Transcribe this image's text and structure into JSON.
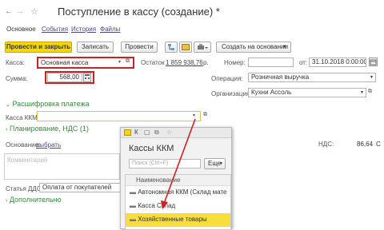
{
  "nav": {
    "back": "←",
    "forward": "→",
    "star": "☆"
  },
  "title": "Поступление в кассу (создание) *",
  "tabs": [
    "Основное",
    "События",
    "История",
    "Файлы"
  ],
  "toolbar": {
    "post_close": "Провести и закрыть",
    "save": "Записать",
    "post": "Провести",
    "create_based": "Создать на основании"
  },
  "form": {
    "cash_label": "Касса:",
    "cash_value": "Основная касса",
    "balance_label": "Остаток",
    "balance_value": "1 859 938,76",
    "currency": "р.",
    "number_label": "Номер:",
    "date_label": "от:",
    "date_value": "31.10.2018  0:00:00",
    "sum_label": "Сумма:",
    "sum_value": "568,00",
    "operation_label": "Операция:",
    "operation_value": "Розничная выручка",
    "org_label": "Организация:",
    "org_value": "Кухни Ассоль",
    "payment_section": "Расшифровка платежа",
    "kkm_label": "Касса ККМ:",
    "vat_section": "Планирование, НДС (1)",
    "basis_label": "Основание:",
    "basis_link": "выбрать",
    "comment_placeholder": "Комментарий",
    "dds_label": "Статья ДДС:",
    "dds_value": "Оплата от покупателей",
    "additional_section": "Дополнительно",
    "vat_label": "НДС:",
    "vat_value": "86,64",
    "vat_suffix": "С"
  },
  "popup": {
    "tab": "К",
    "title": "Кассы ККМ",
    "search_placeholder": "Поиск (Ctrl+F)",
    "more": "Еще",
    "column": "Наименование",
    "items": [
      "Автономная ККМ (Склад мате",
      "Касса Склад",
      "Хозяйственные товары"
    ]
  }
}
